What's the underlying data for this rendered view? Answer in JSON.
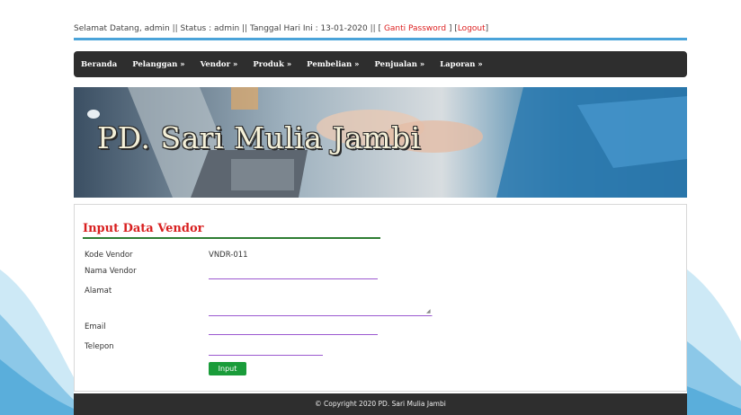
{
  "header": {
    "welcome_text": "Selamat Datang, admin || Status : admin || Tanggal Hari Ini : 13-01-2020 || [",
    "change_password_label": "Ganti Password",
    "mid_sep": " ] [",
    "logout_label": "Logout",
    "end_sep": "]"
  },
  "nav": {
    "items": [
      {
        "label": "Beranda"
      },
      {
        "label": "Pelanggan »"
      },
      {
        "label": "Vendor »"
      },
      {
        "label": "Produk »"
      },
      {
        "label": "Pembelian »"
      },
      {
        "label": "Penjualan »"
      },
      {
        "label": "Laporan »"
      }
    ]
  },
  "banner": {
    "title": "PD. Sari Mulia Jambi"
  },
  "form": {
    "title": "Input Data Vendor",
    "fields": {
      "kode_label": "Kode Vendor",
      "kode_value": "VNDR-011",
      "nama_label": "Nama Vendor",
      "nama_value": "",
      "alamat_label": "Alamat",
      "alamat_value": "",
      "email_label": "Email",
      "email_value": "",
      "telepon_label": "Telepon",
      "telepon_value": ""
    },
    "submit_label": "Input"
  },
  "footer": {
    "copyright": "© Copyright 2020 PD. Sari Mulia Jambi"
  },
  "colors": {
    "nav_bg": "#2e2e2e",
    "accent_line": "#4aa3d9",
    "title_red": "#d81f1f",
    "button_green": "#1a9c3a",
    "field_underline": "#9b59d0"
  }
}
